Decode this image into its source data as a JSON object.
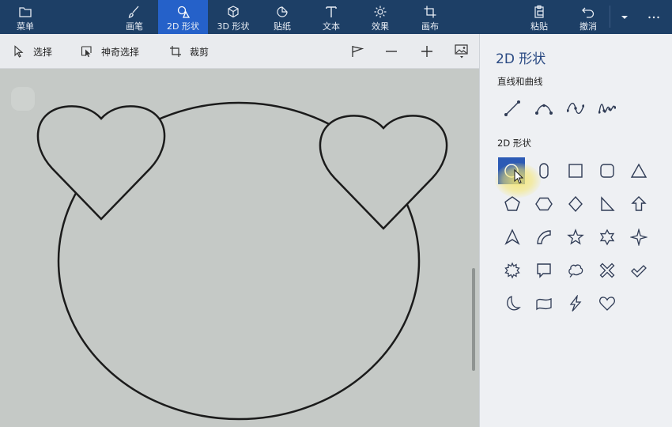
{
  "ribbon": {
    "menu_label": "菜单",
    "tabs": [
      {
        "label": "画笔",
        "icon": "brush-icon"
      },
      {
        "label": "2D 形状",
        "icon": "2d-shapes-icon"
      },
      {
        "label": "3D 形状",
        "icon": "3d-cube-icon"
      },
      {
        "label": "贴纸",
        "icon": "sticker-icon"
      },
      {
        "label": "文本",
        "icon": "text-icon"
      },
      {
        "label": "效果",
        "icon": "effects-sun-icon"
      },
      {
        "label": "画布",
        "icon": "canvas-crop-icon"
      }
    ],
    "active_tab": "2D 形状",
    "paste_label": "粘贴",
    "undo_label": "撤消",
    "accent_color": "#1d3f66",
    "active_color": "#2561c9"
  },
  "toolbar": {
    "select_label": "选择",
    "magic_select_label": "神奇选择",
    "crop_label": "裁剪",
    "right_icons": [
      "flag-icon",
      "zoom-out-icon",
      "zoom-in-icon",
      "image-dropdown-icon"
    ]
  },
  "panel": {
    "title": "2D 形状",
    "lines_title": "直线和曲线",
    "shapes_title": "2D 形状",
    "lines": [
      "line-icon",
      "curve-icon",
      "two-point-curve-icon",
      "three-point-curve-icon"
    ],
    "shapes": [
      "circle-icon",
      "rounded-pill-icon",
      "square-icon",
      "rounded-square-icon",
      "triangle-icon",
      "pentagon-icon",
      "hexagon-icon",
      "diamond-icon",
      "right-triangle-icon",
      "arrow-up-icon",
      "arrowhead-icon",
      "quarter-arc-icon",
      "five-point-star-icon",
      "six-point-star-icon",
      "four-point-star-icon",
      "burst-icon",
      "speech-bubble-icon",
      "thought-bubble-icon",
      "x-cross-icon",
      "checkmark-icon",
      "crescent-moon-icon",
      "banner-icon",
      "lightning-icon",
      "heart-icon"
    ],
    "selected_shape": "circle-icon"
  }
}
